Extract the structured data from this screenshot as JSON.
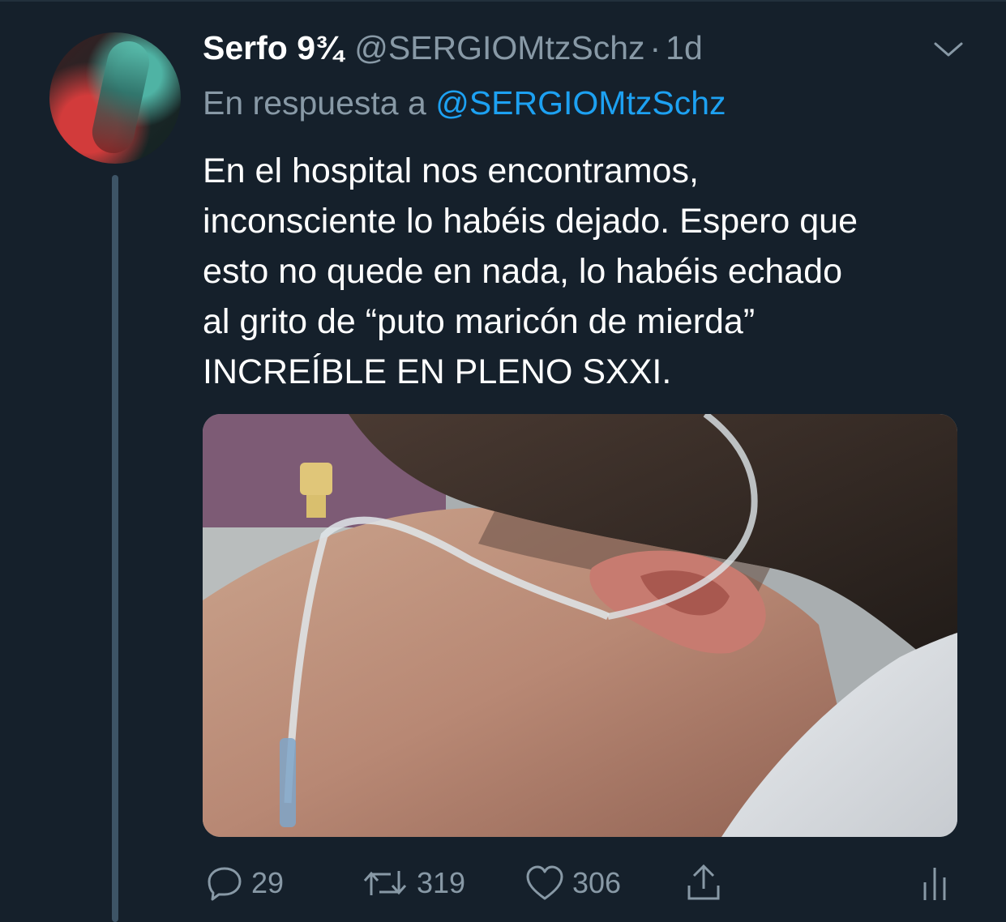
{
  "tweet": {
    "display_name": "Serfo 9¾",
    "handle": "@SERGIOMtzSchz",
    "separator": "·",
    "time": "1d",
    "reply_prefix": "En respuesta a",
    "reply_to": "@SERGIOMtzSchz",
    "text": "En el hospital nos encontramos,\ninconsciente lo habéis dejado. Espero que\nesto no quede en nada, lo habéis echado\nal grito de “puto maricón de mierda”\nINCREÍBLE EN PLENO SXXI."
  },
  "actions": {
    "replies": "29",
    "retweets": "319",
    "likes": "306"
  },
  "colors": {
    "background": "#15202b",
    "secondary_text": "#8899a6",
    "link": "#1da1f2",
    "primary_text": "#ffffff"
  },
  "icons": [
    "chevron-down-icon",
    "reply-icon",
    "retweet-icon",
    "like-icon",
    "share-icon",
    "analytics-icon"
  ]
}
